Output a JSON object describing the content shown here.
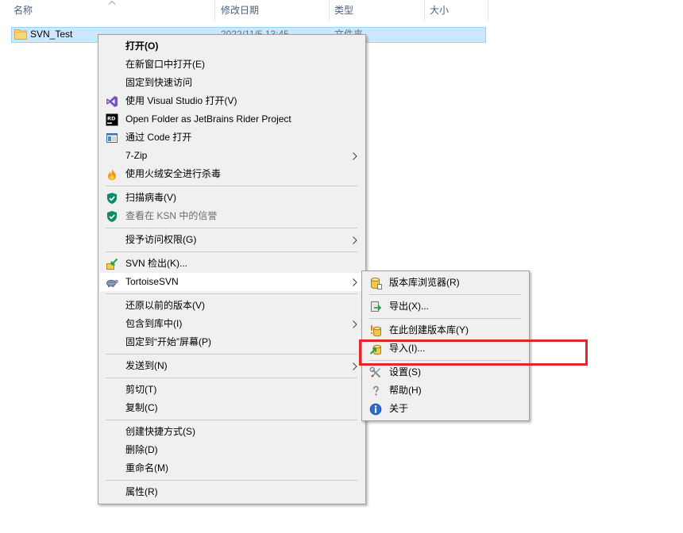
{
  "colors": {
    "selection_fill": "#cce8ff",
    "selection_border": "#99d1ff",
    "menu_background": "#f0f0f0",
    "menu_hover": "#ffffff",
    "highlight_box": "#e3262b",
    "header_text": "#4c607a",
    "disabled_text": "#6d6d6d"
  },
  "explorer": {
    "sort_icon": "chevron-up-icon",
    "columns": {
      "name": "名称",
      "modified": "修改日期",
      "type": "类型",
      "size": "大小"
    },
    "rows": [
      {
        "icon": "folder-icon",
        "name": "SVN_Test",
        "modified": "2022/11/5 13:45",
        "type": "文件夹",
        "selected": true
      }
    ]
  },
  "context_menu": {
    "groups": [
      {
        "items": [
          {
            "label": "打开(O)",
            "bold": true
          },
          {
            "label": "在新窗口中打开(E)"
          },
          {
            "label": "固定到快速访问"
          },
          {
            "label": "使用 Visual Studio 打开(V)",
            "icon": "visual-studio-icon"
          },
          {
            "label": "Open Folder as JetBrains Rider Project",
            "icon": "jetbrains-rider-icon",
            "icon_text": "RD"
          },
          {
            "label": "通过 Code 打开",
            "icon": "code-window-icon"
          },
          {
            "label": "7-Zip",
            "has_submenu": true
          },
          {
            "label": "使用火绒安全进行杀毒",
            "icon": "huorong-flame-icon"
          }
        ]
      },
      {
        "items": [
          {
            "label": "扫描病毒(V)",
            "icon": "kaspersky-shield-icon"
          },
          {
            "label": "查看在 KSN 中的信誉",
            "icon": "kaspersky-shield-icon",
            "disabled": true
          }
        ]
      },
      {
        "items": [
          {
            "label": "授予访问权限(G)",
            "has_submenu": true
          }
        ]
      },
      {
        "items": [
          {
            "label": "SVN 检出(K)...",
            "icon": "svn-checkout-icon"
          },
          {
            "label": "TortoiseSVN",
            "icon": "tortoisesvn-icon",
            "has_submenu": true,
            "hovered": true
          }
        ]
      },
      {
        "items": [
          {
            "label": "还原以前的版本(V)"
          },
          {
            "label": "包含到库中(I)",
            "has_submenu": true
          },
          {
            "label": "固定到“开始”屏幕(P)"
          }
        ]
      },
      {
        "items": [
          {
            "label": "发送到(N)",
            "has_submenu": true
          }
        ]
      },
      {
        "items": [
          {
            "label": "剪切(T)"
          },
          {
            "label": "复制(C)"
          }
        ]
      },
      {
        "items": [
          {
            "label": "创建快捷方式(S)"
          },
          {
            "label": "删除(D)"
          },
          {
            "label": "重命名(M)"
          }
        ]
      },
      {
        "items": [
          {
            "label": "属性(R)"
          }
        ]
      }
    ]
  },
  "tortoisesvn_submenu": {
    "groups": [
      {
        "items": [
          {
            "label": "版本库浏览器(R)",
            "icon": "repo-browser-icon"
          }
        ]
      },
      {
        "items": [
          {
            "label": "导出(X)...",
            "icon": "export-icon"
          }
        ]
      },
      {
        "items": [
          {
            "label": "在此创建版本库(Y)",
            "icon": "create-repository-icon"
          },
          {
            "label": "导入(I)...",
            "icon": "import-icon",
            "outlined_in_red": true
          }
        ]
      },
      {
        "items": [
          {
            "label": "设置(S)",
            "icon": "settings-icon"
          },
          {
            "label": "帮助(H)",
            "icon": "help-icon"
          },
          {
            "label": "关于",
            "icon": "about-icon"
          }
        ]
      }
    ]
  }
}
